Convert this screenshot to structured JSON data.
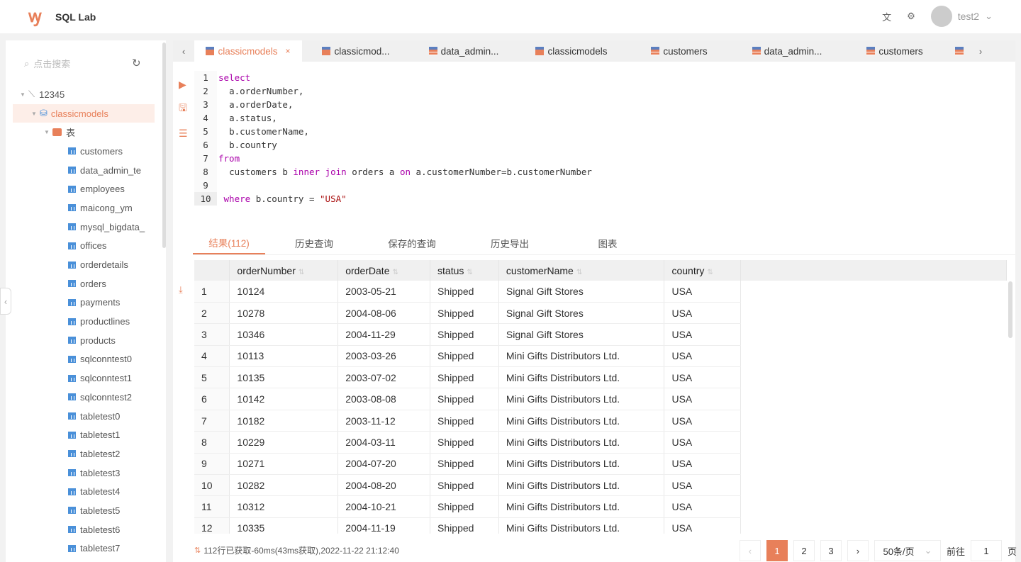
{
  "header": {
    "title": "SQL Lab",
    "user": "test2",
    "icons": [
      "translate-icon",
      "settings-icon"
    ]
  },
  "sidebar": {
    "search_placeholder": "点击搜索",
    "connection": "12345",
    "database": "classicmodels",
    "folder": "表",
    "tables": [
      "customers",
      "data_admin_te",
      "employees",
      "maicong_ym",
      "mysql_bigdata_",
      "offices",
      "orderdetails",
      "orders",
      "payments",
      "productlines",
      "products",
      "sqlconntest0",
      "sqlconntest1",
      "sqlconntest2",
      "tabletest0",
      "tabletest1",
      "tabletest2",
      "tabletest3",
      "tabletest4",
      "tabletest5",
      "tabletest6",
      "tabletest7"
    ]
  },
  "tabs": [
    {
      "label": "classicmodels",
      "type": "db",
      "active": true
    },
    {
      "label": "classicmod...",
      "type": "db"
    },
    {
      "label": "data_admin...",
      "type": "table"
    },
    {
      "label": "classicmodels",
      "type": "db"
    },
    {
      "label": "customers",
      "type": "table"
    },
    {
      "label": "data_admin...",
      "type": "table"
    },
    {
      "label": "customers",
      "type": "table"
    }
  ],
  "editor": {
    "lines": [
      "select",
      "  a.orderNumber,",
      "  a.orderDate,",
      "  a.status,",
      "  b.customerName,",
      "  b.country",
      "from",
      "  customers b inner join orders a on a.customerNumber=b.customerNumber",
      "",
      " where b.country = \"USA\""
    ],
    "current_line": 10
  },
  "result_tabs": [
    "结果(112)",
    "历史查询",
    "保存的查询",
    "历史导出",
    "图表"
  ],
  "table": {
    "columns": [
      "orderNumber",
      "orderDate",
      "status",
      "customerName",
      "country"
    ],
    "rows": [
      [
        "1",
        "10124",
        "2003-05-21",
        "Shipped",
        "Signal Gift Stores",
        "USA"
      ],
      [
        "2",
        "10278",
        "2004-08-06",
        "Shipped",
        "Signal Gift Stores",
        "USA"
      ],
      [
        "3",
        "10346",
        "2004-11-29",
        "Shipped",
        "Signal Gift Stores",
        "USA"
      ],
      [
        "4",
        "10113",
        "2003-03-26",
        "Shipped",
        "Mini Gifts Distributors Ltd.",
        "USA"
      ],
      [
        "5",
        "10135",
        "2003-07-02",
        "Shipped",
        "Mini Gifts Distributors Ltd.",
        "USA"
      ],
      [
        "6",
        "10142",
        "2003-08-08",
        "Shipped",
        "Mini Gifts Distributors Ltd.",
        "USA"
      ],
      [
        "7",
        "10182",
        "2003-11-12",
        "Shipped",
        "Mini Gifts Distributors Ltd.",
        "USA"
      ],
      [
        "8",
        "10229",
        "2004-03-11",
        "Shipped",
        "Mini Gifts Distributors Ltd.",
        "USA"
      ],
      [
        "9",
        "10271",
        "2004-07-20",
        "Shipped",
        "Mini Gifts Distributors Ltd.",
        "USA"
      ],
      [
        "10",
        "10282",
        "2004-08-20",
        "Shipped",
        "Mini Gifts Distributors Ltd.",
        "USA"
      ],
      [
        "11",
        "10312",
        "2004-10-21",
        "Shipped",
        "Mini Gifts Distributors Ltd.",
        "USA"
      ],
      [
        "12",
        "10335",
        "2004-11-19",
        "Shipped",
        "Mini Gifts Distributors Ltd.",
        "USA"
      ]
    ]
  },
  "footer": {
    "status": "112行已获取-60ms(43ms获取),2022-11-22 21:12:40",
    "pages": [
      "1",
      "2",
      "3"
    ],
    "current_page": "1",
    "page_size": "50条/页",
    "goto_label": "前往",
    "goto_value": "1",
    "page_unit": "页"
  },
  "colors": {
    "accent": "#e8805a"
  }
}
